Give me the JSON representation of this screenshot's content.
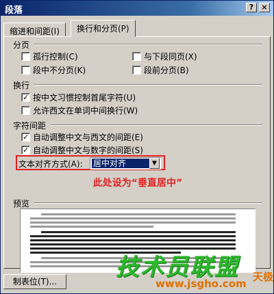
{
  "window": {
    "title": "段落",
    "help_glyph": "?",
    "close_glyph": "×"
  },
  "tabs": [
    {
      "label": "缩进和间距(I)",
      "active": false
    },
    {
      "label": "换行和分页(P)",
      "active": true
    }
  ],
  "pagination": {
    "heading": "分页",
    "options": [
      {
        "label": "孤行控制(C)",
        "checked": false
      },
      {
        "label": "与下段同页(X)",
        "checked": false
      },
      {
        "label": "段中不分页(K)",
        "checked": false
      },
      {
        "label": "段前分页(B)",
        "checked": false
      }
    ]
  },
  "line_break": {
    "heading": "换行",
    "options": [
      {
        "label": "按中文习惯控制首尾字符(U)",
        "checked": true
      },
      {
        "label": "允许西文在单词中间换行(W)",
        "checked": false
      }
    ]
  },
  "char_spacing": {
    "heading": "字符间距",
    "options": [
      {
        "label": "自动调整中文与西文的间距(E)",
        "checked": true
      },
      {
        "label": "自动调整中文与数字的间距(S)",
        "checked": true
      }
    ],
    "alignment_label": "文本对齐方式(A):",
    "alignment_value": "居中对齐"
  },
  "annotation": "此处设为“垂直居中”",
  "preview": {
    "heading": "预览"
  },
  "tab_stops_button": "制表位(T)...",
  "watermark": {
    "main": "技术员联盟",
    "url": "www.jsgho.com",
    "corner": "天极"
  },
  "colors": {
    "highlight": "#e02020",
    "title_bar": "#0a246a",
    "watermark_green": "#2db82d",
    "watermark_orange": "#e07000"
  }
}
